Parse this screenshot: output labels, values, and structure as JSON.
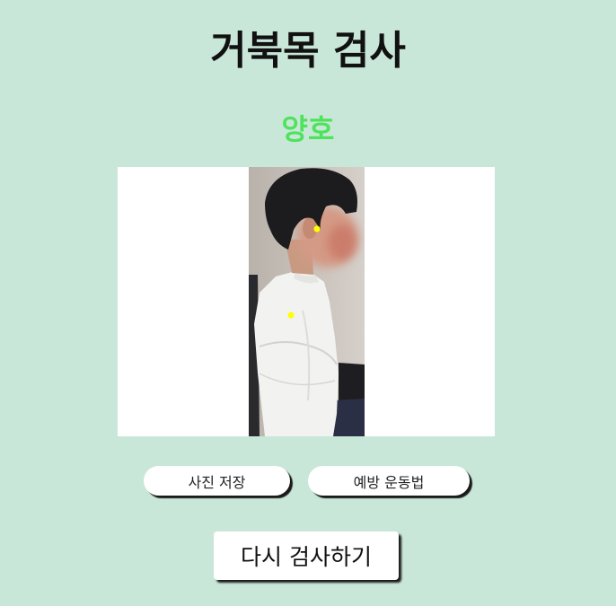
{
  "page": {
    "title": "거북목 검사",
    "result_label": "양호",
    "result_color": "#4ee35a"
  },
  "photo": {
    "description_icon": "side-profile-photo",
    "landmark_color": "#ffff00",
    "landmarks": [
      "ear-landmark",
      "shoulder-landmark"
    ]
  },
  "buttons": {
    "save_photo": "사진 저장",
    "prevention_exercise": "예방 운동법",
    "retest": "다시 검사하기"
  }
}
